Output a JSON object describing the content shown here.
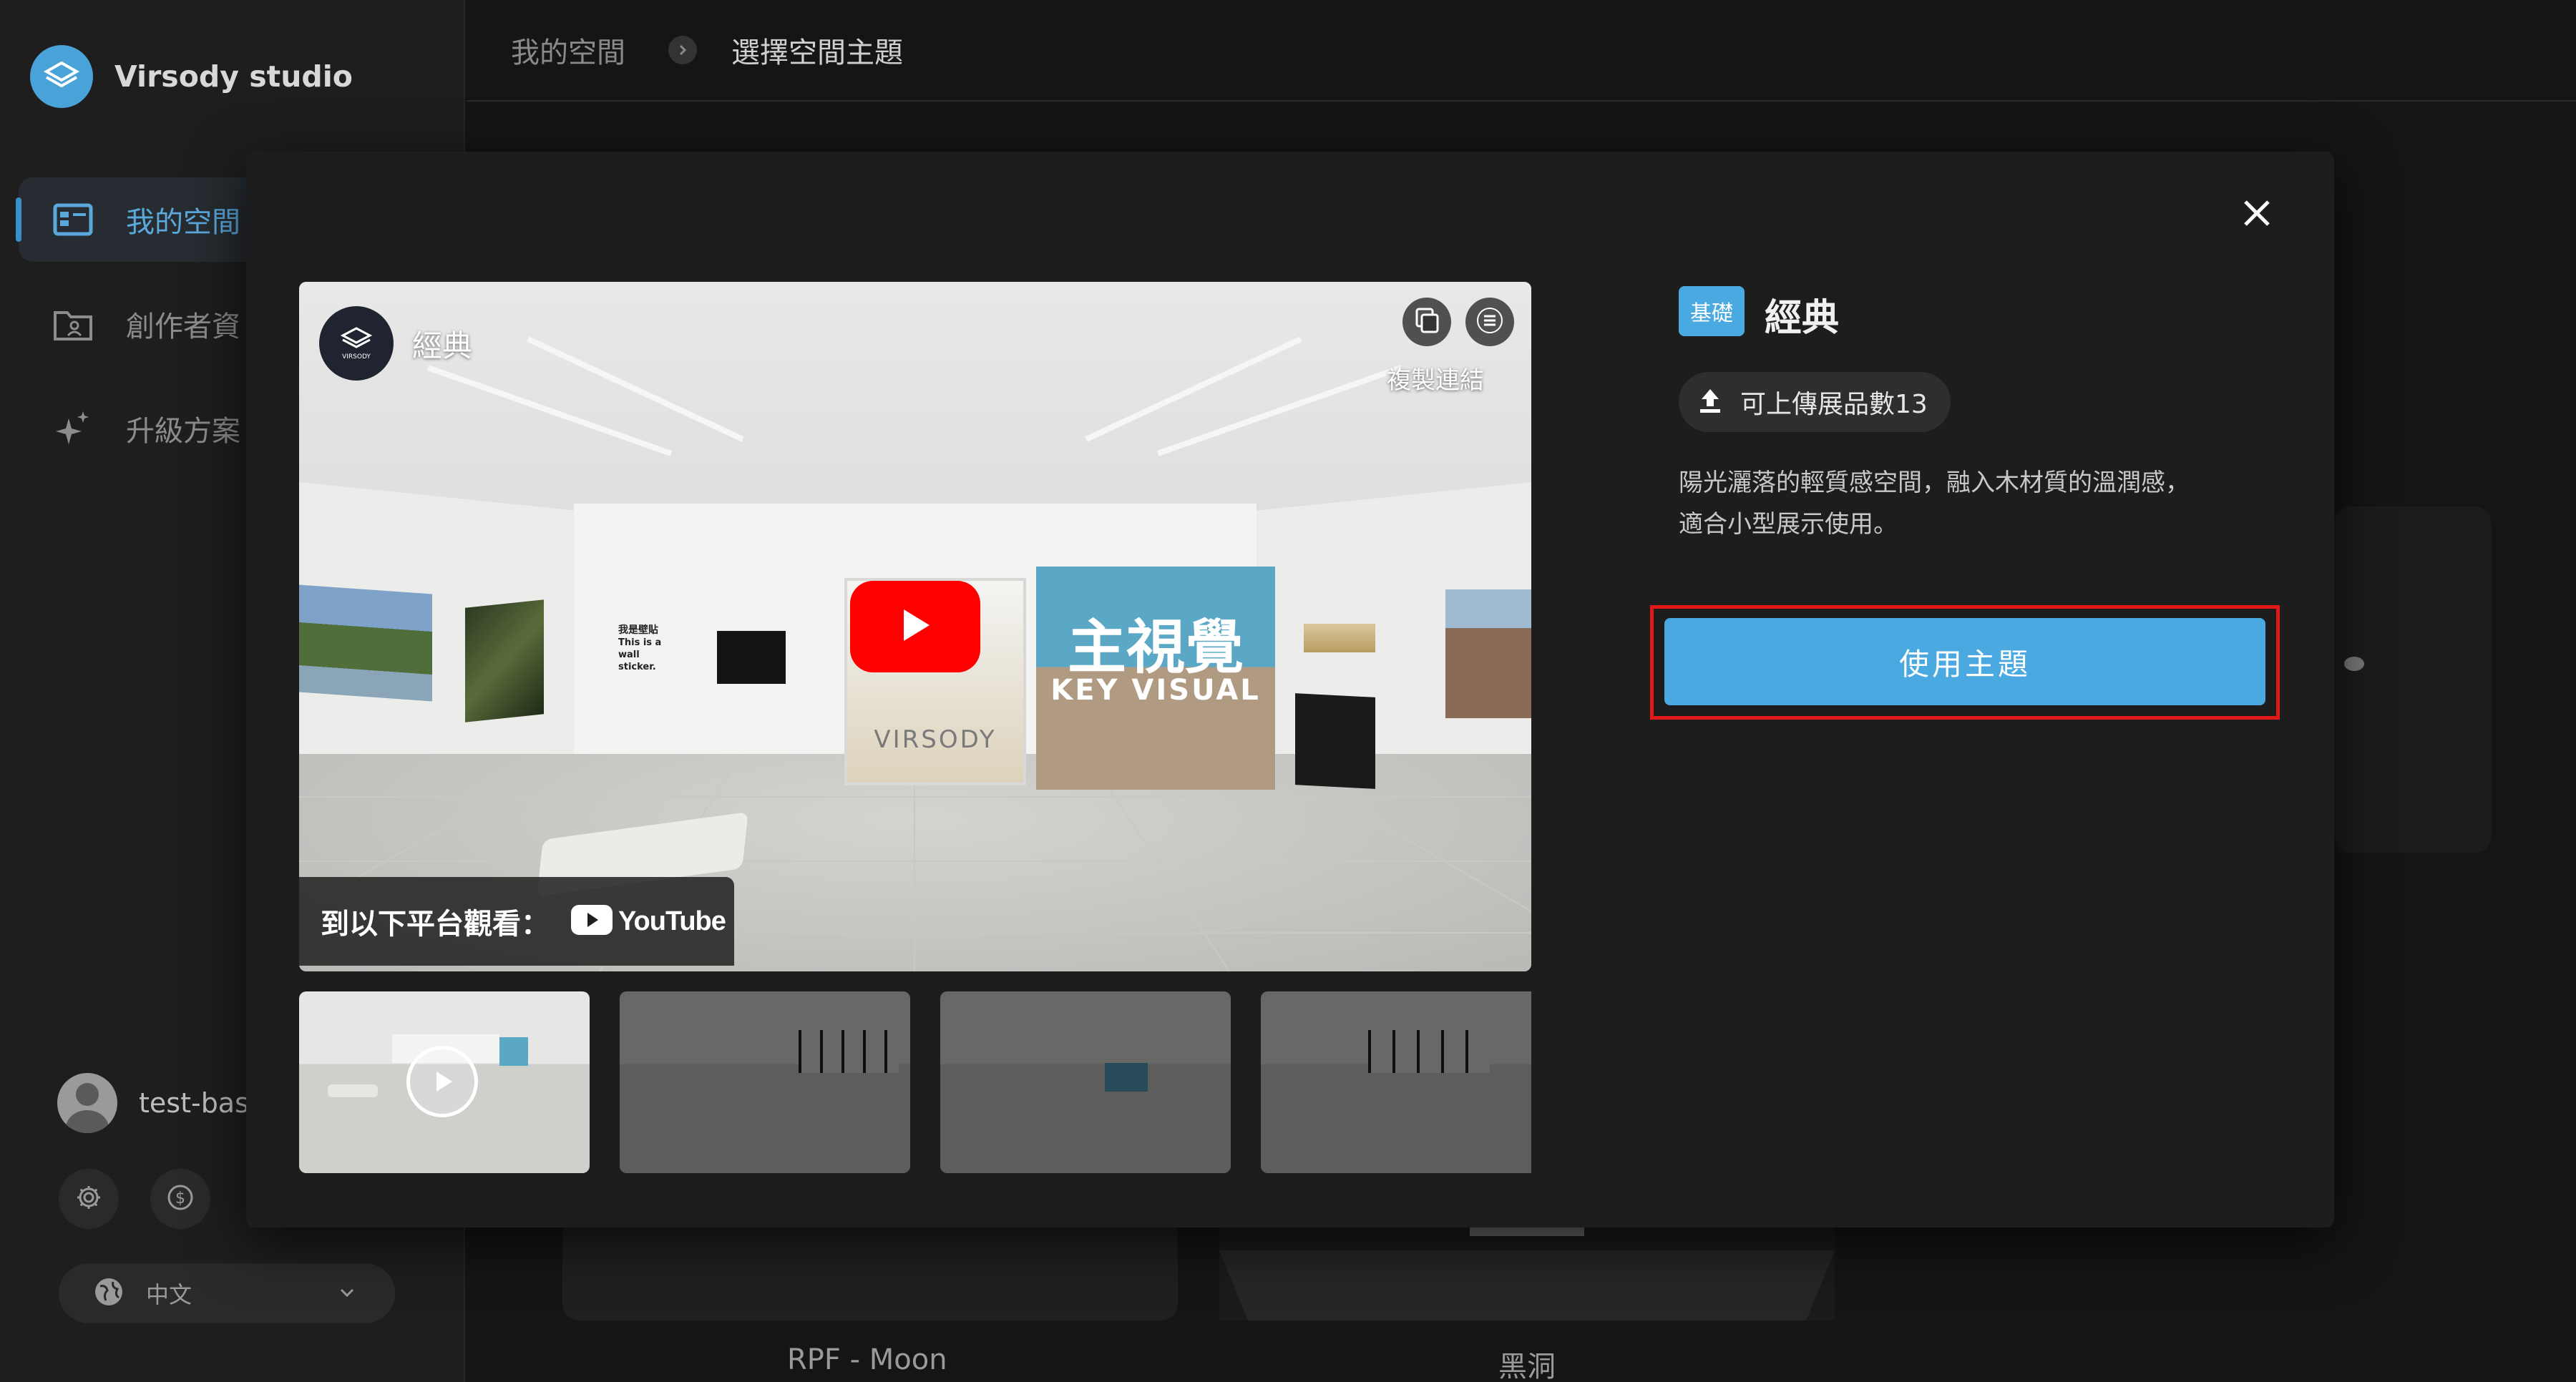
{
  "app": {
    "name": "Virsody studio"
  },
  "sidebar": {
    "items": [
      {
        "label": "我的空間",
        "icon": "dashboard-icon",
        "active": true
      },
      {
        "label": "創作者資",
        "icon": "profile-folder-icon",
        "active": false
      },
      {
        "label": "升級方案",
        "icon": "sparkle-icon",
        "active": false
      }
    ],
    "user": {
      "name": "test-basic"
    },
    "icons": [
      "gear-icon",
      "dollar-icon"
    ],
    "language": {
      "value": "中文",
      "icon": "globe-icon"
    }
  },
  "breadcrumb": {
    "items": [
      "我的空間",
      "選擇空間主題"
    ]
  },
  "background_cards": [
    {
      "caption": "RPF - Moon"
    },
    {
      "caption": "黑洞"
    }
  ],
  "modal": {
    "close_icon": "close-icon",
    "video": {
      "title": "經典",
      "channel": "VIRSODY",
      "copy_link_label": "複製連結",
      "watch_on_label": "到以下平台觀看：",
      "youtube_label": "YouTube",
      "art_text": {
        "sticker_title": "我是壁貼",
        "sticker_body": [
          "This is a",
          "wall",
          "sticker."
        ],
        "key_visual_cn": "主視覺",
        "key_visual_en": "KEY VISUAL",
        "brand": "VIRSODY"
      }
    },
    "thumbnails": [
      {
        "selected": true
      },
      {
        "selected": false
      },
      {
        "selected": false
      },
      {
        "selected": false
      }
    ],
    "details": {
      "tier_badge": "基礎",
      "name": "經典",
      "upload_count_label": "可上傳展品數13",
      "description_lines": [
        "陽光灑落的輕質感空間，融入木材質的溫潤感，",
        "適合小型展示使用。"
      ],
      "cta_label": "使用主題"
    }
  },
  "colors": {
    "accent": "#4aa9e0",
    "highlight_outline": "#e01818",
    "youtube_red": "#ff0000",
    "background": "#151515"
  }
}
